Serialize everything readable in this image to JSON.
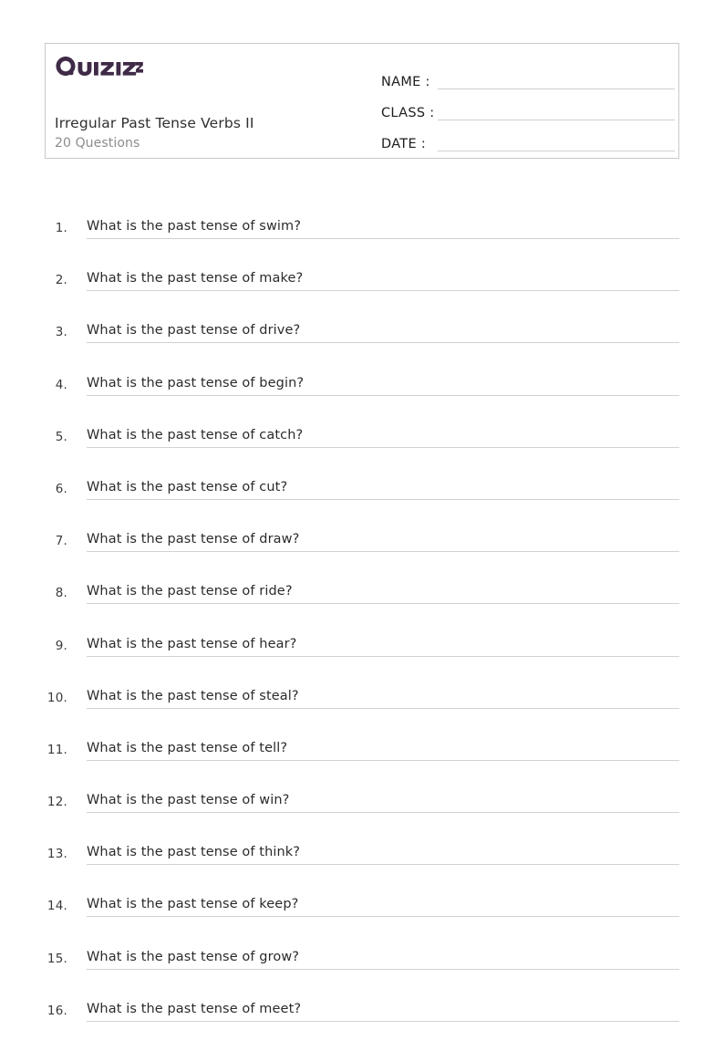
{
  "header": {
    "logo_text": "Quizizz",
    "logo_icon": "quizizz-logo",
    "logo_color": "#3f2a47",
    "title": "Irregular Past Tense Verbs II",
    "subtitle": "20 Questions"
  },
  "meta": {
    "name_label": "NAME :",
    "class_label": "CLASS :",
    "date_label": "DATE  :",
    "name_value": "",
    "class_value": "",
    "date_value": ""
  },
  "questions": [
    {
      "number": "1.",
      "text": "What is the past tense of swim?"
    },
    {
      "number": "2.",
      "text": "What is the past tense of make?"
    },
    {
      "number": "3.",
      "text": "What is the past tense of drive?"
    },
    {
      "number": "4.",
      "text": "What is the past tense of begin?"
    },
    {
      "number": "5.",
      "text": "What is the past tense of catch?"
    },
    {
      "number": "6.",
      "text": "What is the past tense of cut?"
    },
    {
      "number": "7.",
      "text": "What is the past tense of draw?"
    },
    {
      "number": "8.",
      "text": "What is the past tense of ride?"
    },
    {
      "number": "9.",
      "text": "What is the past tense of hear?"
    },
    {
      "number": "10.",
      "text": "What is the past tense of steal?"
    },
    {
      "number": "11.",
      "text": "What is the past tense of tell?"
    },
    {
      "number": "12.",
      "text": "What is the past tense of win?"
    },
    {
      "number": "13.",
      "text": "What is the past tense of think?"
    },
    {
      "number": "14.",
      "text": "What is the past tense of keep?"
    },
    {
      "number": "15.",
      "text": "What is the past tense of grow?"
    },
    {
      "number": "16.",
      "text": "What is the past tense of meet?"
    }
  ]
}
